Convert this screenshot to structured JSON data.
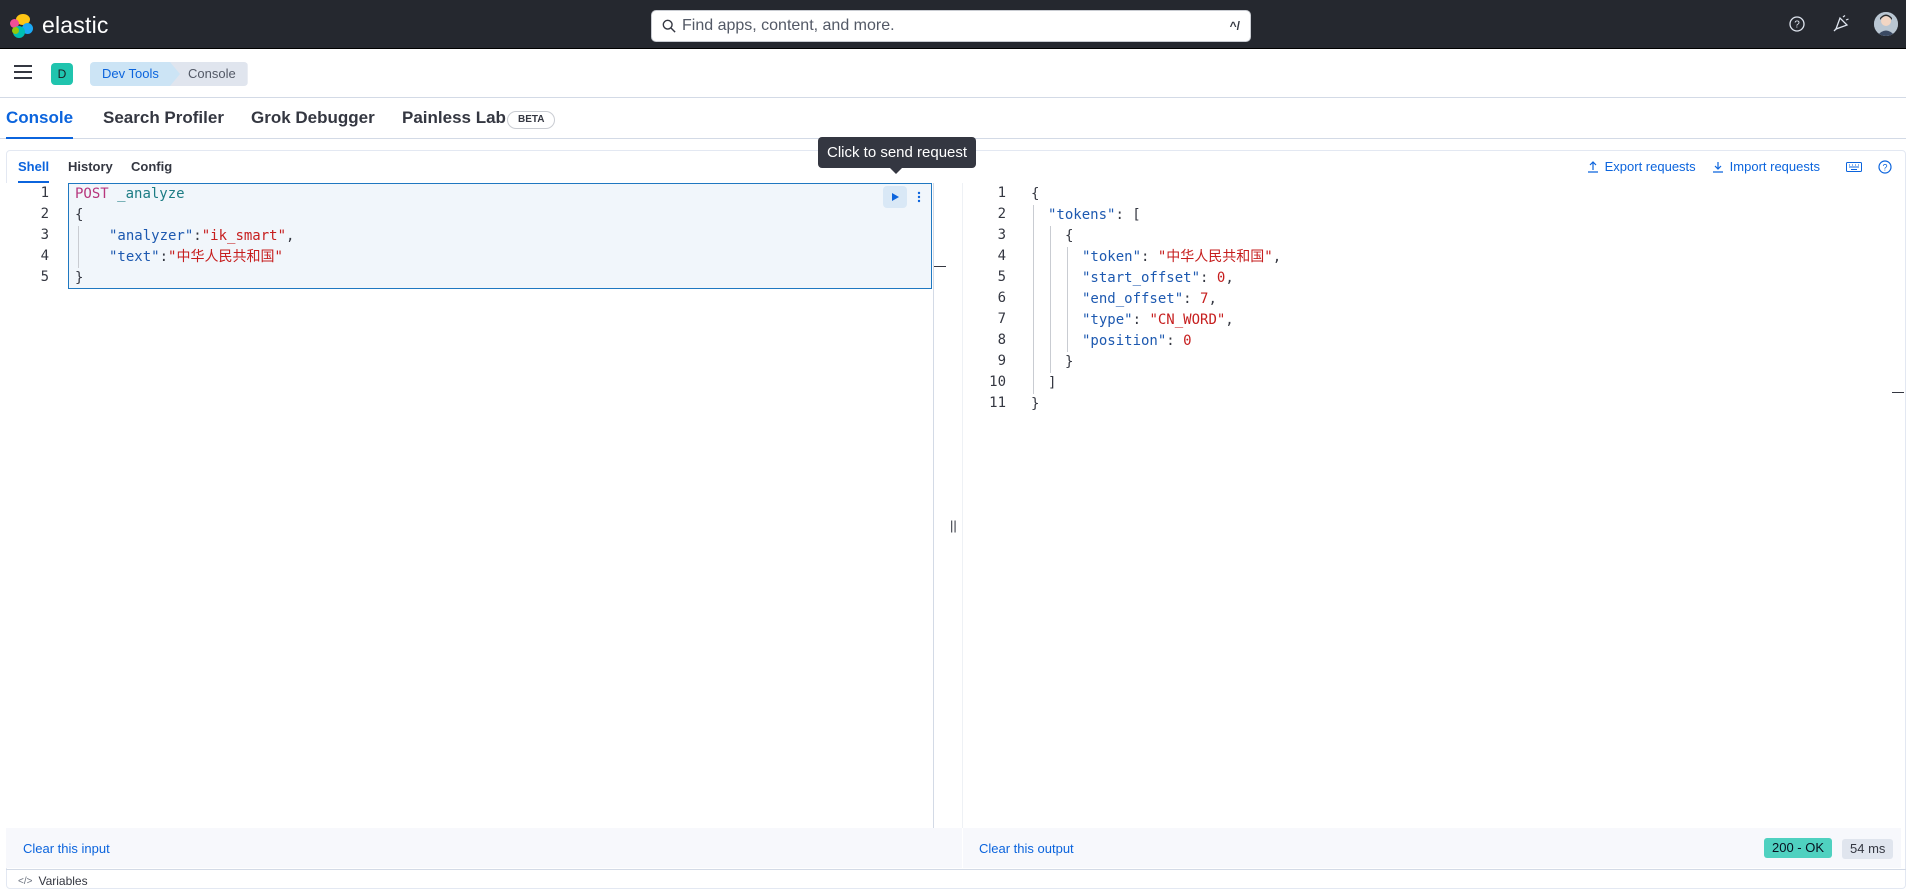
{
  "header": {
    "brand": "elastic",
    "search_placeholder": "Find apps, content, and more.",
    "search_shortcut": "^/"
  },
  "breadcrumbs": {
    "space_initial": "D",
    "items": [
      "Dev Tools",
      "Console"
    ]
  },
  "tabs": [
    {
      "label": "Console",
      "active": true
    },
    {
      "label": "Search Profiler"
    },
    {
      "label": "Grok Debugger"
    },
    {
      "label": "Painless Lab"
    }
  ],
  "beta_badge": "BETA",
  "console": {
    "subtabs": [
      "Shell",
      "History",
      "Config"
    ],
    "export_label": "Export requests",
    "import_label": "Import requests",
    "tooltip": "Click to send request",
    "input_lines": [
      "1",
      "2",
      "3",
      "4",
      "5"
    ],
    "input": {
      "method": "POST",
      "endpoint": "_analyze",
      "analyzer_key": "\"analyzer\"",
      "analyzer_val": "\"ik_smart\"",
      "text_key": "\"text\"",
      "text_val": "\"中华人民共和国\""
    },
    "output_lines": [
      "1",
      "2",
      "3",
      "4",
      "5",
      "6",
      "7",
      "8",
      "9",
      "10",
      "11"
    ],
    "output": {
      "tokens_key": "\"tokens\"",
      "token_key": "\"token\"",
      "token_val": "\"中华人民共和国\"",
      "start_key": "\"start_offset\"",
      "start_val": "0",
      "end_key": "\"end_offset\"",
      "end_val": "7",
      "type_key": "\"type\"",
      "type_val": "\"CN_WORD\"",
      "position_key": "\"position\"",
      "position_val": "0"
    },
    "clear_input": "Clear this input",
    "clear_output": "Clear this output",
    "status": "200 - OK",
    "duration": "54 ms",
    "variables_label": "Variables"
  },
  "colors": {
    "header_bg": "#25282f",
    "accent": "#0b64dd",
    "status_ok": "#4fd1c0"
  }
}
